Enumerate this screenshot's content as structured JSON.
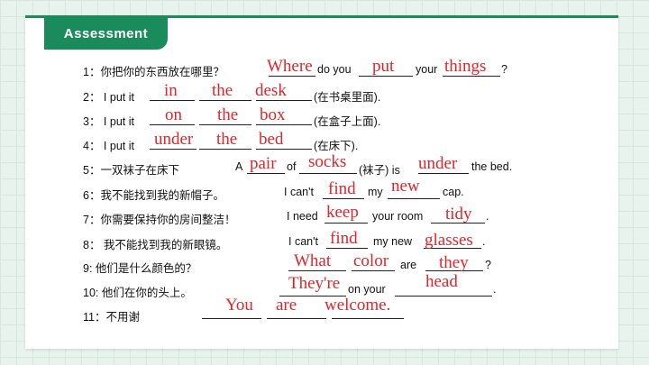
{
  "header": {
    "title": "Assessment"
  },
  "rows": [
    {
      "prompt": "1：你把你的东西放在哪里？",
      "p1": "do you",
      "p2": "your",
      "p3": "?",
      "answers": [
        "Where",
        "put",
        "things"
      ]
    },
    {
      "prompt": "2：   I put it",
      "p1": "(在书桌里面).",
      "answers": [
        "in",
        "the",
        "desk"
      ]
    },
    {
      "prompt": "3：   I put it",
      "p1": "(在盒子上面).",
      "answers": [
        "on",
        "the",
        "box"
      ]
    },
    {
      "prompt": "4：   I put it",
      "p1": "(在床下).",
      "answers": [
        "under",
        "the",
        "bed"
      ]
    },
    {
      "prompt": "5：一双袜子在床下",
      "p1": "A",
      "p2": "of",
      "p3": "(袜子) is",
      "p4": "the bed.",
      "answers": [
        "pair",
        "socks",
        "under"
      ]
    },
    {
      "prompt": "6：我不能找到我的新帽子。",
      "p1": "I can't",
      "p2": "my",
      "p3": "cap.",
      "answers": [
        "find",
        "new"
      ]
    },
    {
      "prompt": "7：你需要保持你的房间整洁！",
      "p1": "I need",
      "p2": "your room",
      "p3": ".",
      "answers": [
        "keep",
        "tidy"
      ]
    },
    {
      "prompt": "8：  我不能找到我的新眼镜。",
      "p1": "I can't",
      "p2": "my new",
      "p3": ".",
      "answers": [
        "find",
        "glasses"
      ]
    },
    {
      "prompt": "9: 他们是什么颜色的？",
      "p1": "are",
      "p2": "?",
      "answers": [
        "What",
        "color",
        "they"
      ]
    },
    {
      "prompt": "10: 他们在你的头上。",
      "p1": "on your",
      "p2": ".",
      "answers": [
        "They're",
        "head"
      ]
    },
    {
      "prompt": "11：不用谢",
      "answers": [
        "You",
        "are",
        "welcome."
      ]
    }
  ]
}
